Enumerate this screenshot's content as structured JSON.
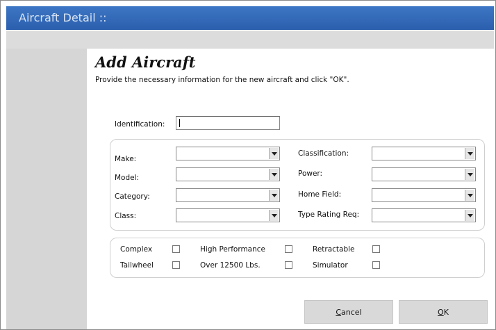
{
  "window": {
    "title": "Aircraft Detail ::"
  },
  "form": {
    "heading": "Add Aircraft",
    "instructions": "Provide the necessary information for the new aircraft and click \"OK\".",
    "identification_label": "Identification:",
    "identification_value": ""
  },
  "details": {
    "make_label": "Make:",
    "model_label": "Model:",
    "category_label": "Category:",
    "class_label": "Class:",
    "classification_label": "Classification:",
    "power_label": "Power:",
    "home_field_label": "Home Field:",
    "type_rating_label": "Type Rating Req:"
  },
  "options": {
    "complex_label": "Complex",
    "high_performance_label": "High Performance",
    "retractable_label": "Retractable",
    "tailwheel_label": "Tailwheel",
    "over_12500_label": "Over 12500 Lbs.",
    "simulator_label": "Simulator"
  },
  "buttons": {
    "cancel_first": "C",
    "cancel_rest": "ancel",
    "ok_first": "O",
    "ok_rest": "K"
  }
}
